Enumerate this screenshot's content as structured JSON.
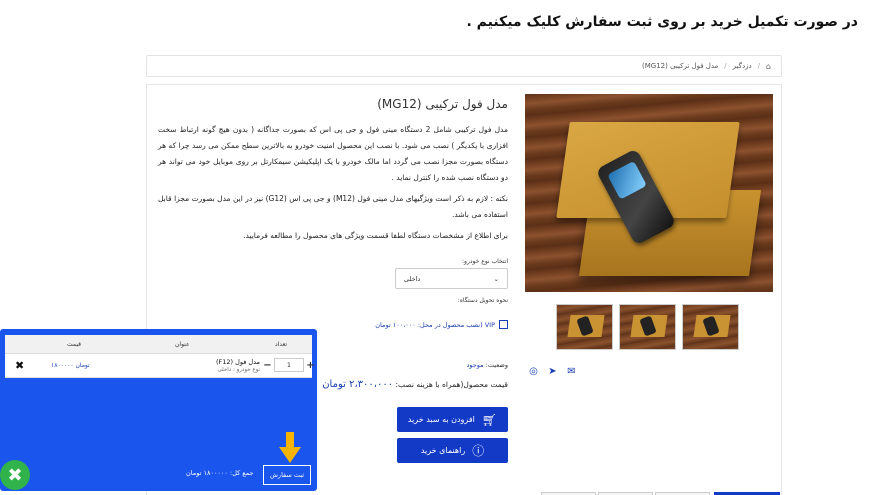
{
  "instruction": "در صورت تکمیل خرید بر روی ثبت سفارش کلیک میکنیم .",
  "breadcrumb": {
    "items": [
      "دزدگیر",
      "مدل فول ترکیبی (MG12)"
    ],
    "separator": "/"
  },
  "product": {
    "title": "مدل فول ترکیبی (MG12)",
    "desc_1": "مدل فول ترکیبی شامل 2 دستگاه مینی فول و جی پی اس که بصورت جداگانه ( بدون هیچ گونه ارتباط سخت افزاری با یکدیگر ) نصب می شود. با نصب این محصول امنیت خودرو به بالاترین سطح ممکن می رسد چرا که هر دستگاه بصورت مجزا نصب می گردد اما مالک خودرو با یک اپلیکیشن سیمکارتل بر روی موبایل خود می تواند هر دو دستگاه نصب شده را کنترل نماید .",
    "desc_2": "نکته : لازم به ذکر است ویژگیهای مدل مینی فول (M12) و جی پی اس (G12) نیز در این مدل بصورت مجزا قابل استفاده می باشد.",
    "desc_3": "برای اطلاع از مشخصات دستگاه لطفا قسمت ویژگی های محصول را مطالعه فرمایید.",
    "car_type_label": "انتخاب نوع خودرو:",
    "car_type_value": "داخلی",
    "install_label": "نحوه تحویل دستگاه:",
    "vip_label": "VIP (نصب محصول در محل: ۱۰۰،۰۰۰ تومان",
    "status_label": "وضعیت:",
    "status_value": "موجود",
    "price_label": "قیمت محصول(همراه با هزینه نصب:",
    "price_value": "۲،۳۰۰،۰۰۰ تومان",
    "add_to_cart": "افزودن به سبد خرید",
    "buy_guide": "راهنمای خرید"
  },
  "cart": {
    "headers": {
      "qty": "تعداد",
      "title": "عنوان",
      "price": "قیمت"
    },
    "items": [
      {
        "name": "مدل فول (F12)",
        "sub": "نوع خودرو : داخلی",
        "qty": "1",
        "price": "۱۸۰۰۰۰۰ تومان"
      }
    ],
    "total_label": "جمع کل:",
    "total_value": "۱۸۰۰۰۰۰ تومان",
    "checkout": "ثبت سفارش"
  },
  "icons": {
    "home": "home-icon",
    "close": "close-icon",
    "cart": "cart-icon",
    "info": "info-icon"
  },
  "colors": {
    "accent": "#1339c7",
    "cart_bg": "#1a55ee",
    "arrow": "#f4b400",
    "close": "#2fb34a"
  }
}
